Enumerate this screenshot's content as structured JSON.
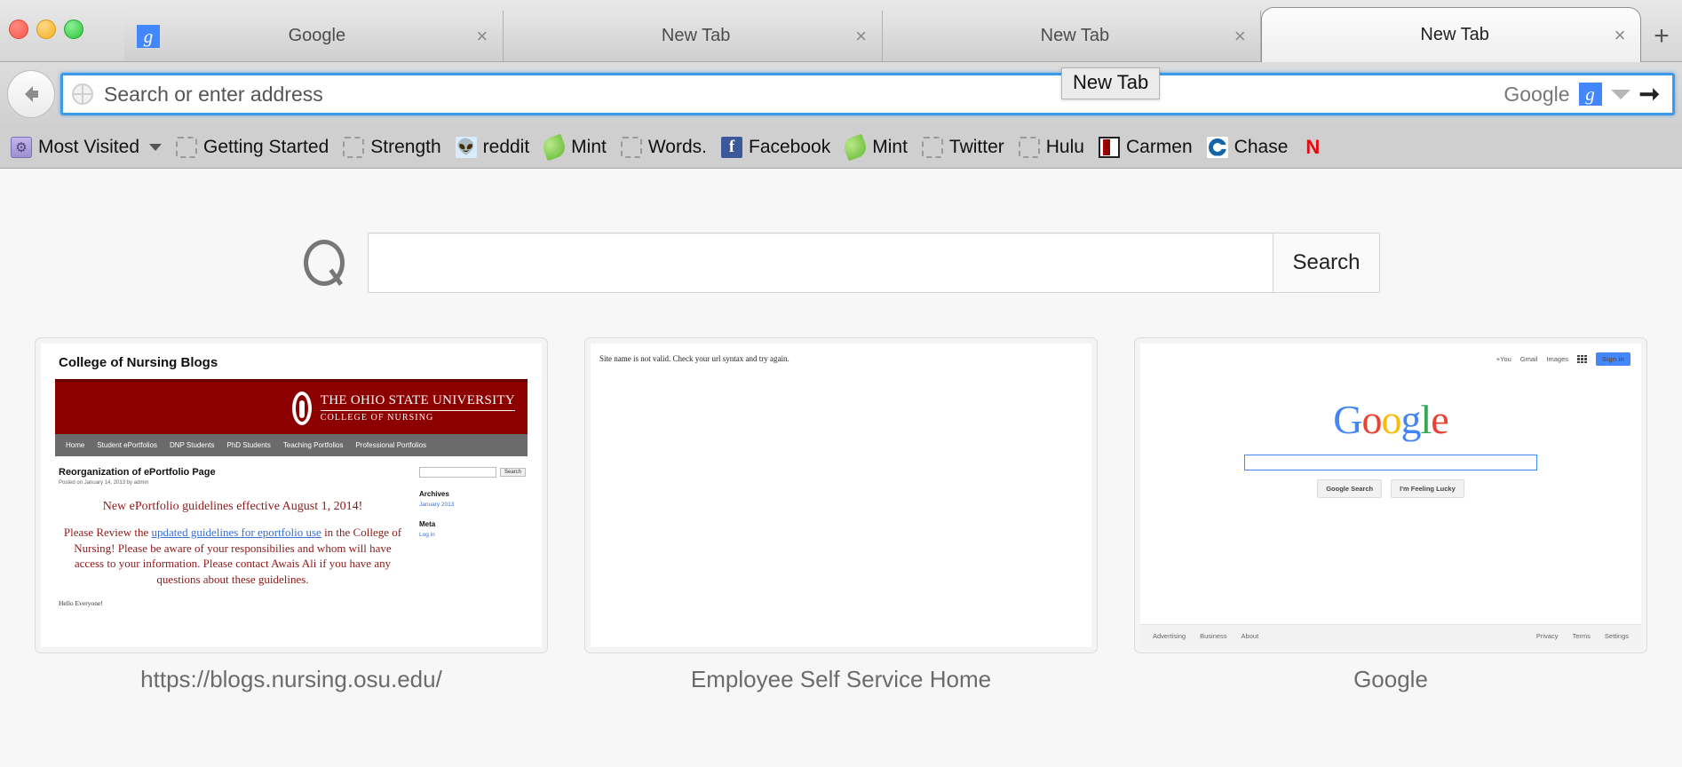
{
  "window": {
    "traffic_lights": [
      "close",
      "minimize",
      "zoom"
    ]
  },
  "tabs": [
    {
      "title": "Google",
      "favicon": "google-g-icon",
      "close_label": "×",
      "active": false
    },
    {
      "title": "New Tab",
      "favicon": "none",
      "close_label": "×",
      "active": false
    },
    {
      "title": "New Tab",
      "favicon": "none",
      "close_label": "×",
      "active": false
    },
    {
      "title": "New Tab",
      "favicon": "none",
      "close_label": "×",
      "active": true
    }
  ],
  "new_tab_button": {
    "label": "+",
    "icon": "plus-icon"
  },
  "navbar": {
    "back_icon": "back-arrow-icon",
    "identity_icon": "globe-icon",
    "url_value": "",
    "url_placeholder": "Search or enter address",
    "search_engine": "Google",
    "search_engine_icon": "google-g-icon",
    "dropdown_icon": "chevron-down-icon",
    "go_icon": "arrow-right-icon",
    "tooltip": "New Tab",
    "focus_color": "#3d9ae8"
  },
  "bookmarks": [
    {
      "label": "Most Visited",
      "icon": "folder-icon",
      "has_caret": true
    },
    {
      "label": "Getting Started",
      "icon": "blank-page-icon",
      "has_caret": false
    },
    {
      "label": "Strength",
      "icon": "blank-page-icon",
      "has_caret": false
    },
    {
      "label": "reddit",
      "icon": "reddit-icon",
      "has_caret": false
    },
    {
      "label": "Mint",
      "icon": "mint-leaf-icon",
      "has_caret": false
    },
    {
      "label": "Words.",
      "icon": "blank-page-icon",
      "has_caret": false
    },
    {
      "label": "Facebook",
      "icon": "facebook-icon",
      "has_caret": false
    },
    {
      "label": "Mint",
      "icon": "mint-leaf-icon",
      "has_caret": false
    },
    {
      "label": "Twitter",
      "icon": "blank-page-icon",
      "has_caret": false
    },
    {
      "label": "Hulu",
      "icon": "blank-page-icon",
      "has_caret": false
    },
    {
      "label": "Carmen",
      "icon": "carmen-icon",
      "has_caret": false
    },
    {
      "label": "Chase",
      "icon": "chase-icon",
      "has_caret": false
    },
    {
      "label": "",
      "icon": "netflix-icon",
      "has_caret": false
    }
  ],
  "content": {
    "search": {
      "icon": "magnifier-icon",
      "value": "",
      "placeholder": "",
      "button_label": "Search"
    },
    "thumbnails": [
      {
        "label": "https://blogs.nursing.osu.edu/",
        "kind": "osu-nursing-blog",
        "page": {
          "site_title": "College of Nursing Blogs",
          "banner_org": "THE OHIO STATE UNIVERSITY",
          "banner_unit": "COLLEGE OF NURSING",
          "nav": [
            "Home",
            "Student ePortfolios",
            "DNP Students",
            "PhD Students",
            "Teaching Portfolios",
            "Professional Portfolios"
          ],
          "post_title": "Reorganization of ePortfolio Page",
          "post_meta": "Posted on January 14, 2013 by admin",
          "headline": "New ePortfolio guidelines effective August 1, 2014!",
          "body_before_link": "Please Review the ",
          "body_link": "updated guidelines for eportfolio use",
          "body_after_link": " in the College of Nursing! Please be aware of your responsibilies and whom will have access to your information. Please contact Awais Ali if you have any questions about these guidelines.",
          "hello": "Hello Everyone!",
          "sidebar_search_button": "Search",
          "sidebar_archives_heading": "Archives",
          "sidebar_archives_item": "January 2013",
          "sidebar_meta_heading": "Meta",
          "sidebar_meta_item": "Log in"
        }
      },
      {
        "label": "Employee Self Service Home",
        "kind": "error-page",
        "page": {
          "message": "Site name is not valid. Check your url syntax and try again."
        }
      },
      {
        "label": "Google",
        "kind": "google-home",
        "page": {
          "top_links": [
            "+You",
            "Gmail",
            "Images"
          ],
          "apps_icon": "apps-grid-icon",
          "sign_in": "Sign in",
          "logo_letters": [
            {
              "c": "G",
              "color": "#4285f4"
            },
            {
              "c": "o",
              "color": "#ea4335"
            },
            {
              "c": "o",
              "color": "#fbbc05"
            },
            {
              "c": "g",
              "color": "#4285f4"
            },
            {
              "c": "l",
              "color": "#34a853"
            },
            {
              "c": "e",
              "color": "#ea4335"
            }
          ],
          "search_value": "",
          "buttons": [
            "Google Search",
            "I'm Feeling Lucky"
          ],
          "footer_left": [
            "Advertising",
            "Business",
            "About"
          ],
          "footer_right": [
            "Privacy",
            "Terms",
            "Settings"
          ]
        }
      }
    ]
  }
}
